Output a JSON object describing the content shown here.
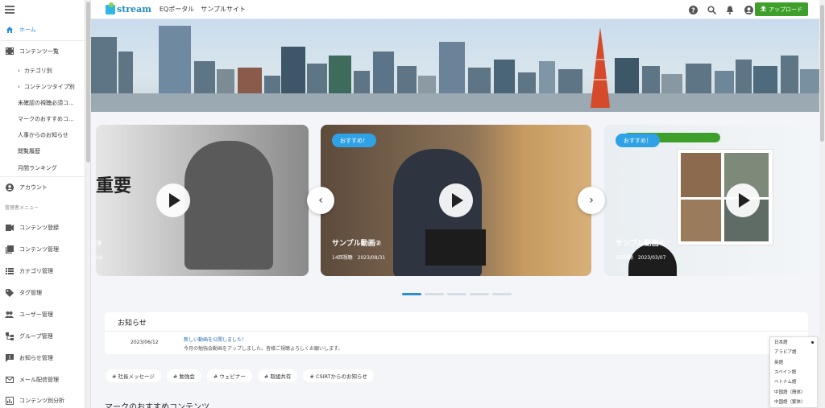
{
  "header": {
    "logo_text": "stream",
    "portal_label": "EQポータル",
    "site_label": "サンプルサイト",
    "upload_label": "アップロード",
    "icons": [
      "help-icon",
      "search-icon",
      "bell-icon",
      "account-icon"
    ]
  },
  "sidebar": {
    "items": [
      {
        "label": "ホーム",
        "icon": "home-icon"
      },
      {
        "label": "コンテンツ一覧",
        "icon": "film-icon"
      },
      {
        "label": "カテゴリ別"
      },
      {
        "label": "コンテンツタイプ別"
      },
      {
        "label": "未確認の視聴必須コ..."
      },
      {
        "label": "マークのおすすめコ..."
      },
      {
        "label": "人事からのお知らせ"
      },
      {
        "label": "閲覧履歴"
      },
      {
        "label": "月間ランキング"
      },
      {
        "label": "アカウント",
        "icon": "account-circle-icon"
      }
    ],
    "admin_section": "管理者メニュー",
    "admin_items": [
      {
        "label": "コンテンツ登録",
        "icon": "video-add-icon"
      },
      {
        "label": "コンテンツ管理",
        "icon": "video-library-icon"
      },
      {
        "label": "カテゴリ管理",
        "icon": "list-icon"
      },
      {
        "label": "タグ管理",
        "icon": "tag-icon"
      },
      {
        "label": "ユーザー管理",
        "icon": "people-icon"
      },
      {
        "label": "グループ管理",
        "icon": "group-tree-icon"
      },
      {
        "label": "お知らせ管理",
        "icon": "announcement-icon"
      },
      {
        "label": "メール配信管理",
        "icon": "mail-icon"
      },
      {
        "label": "コンテンツ別分析",
        "icon": "analytics-icon"
      }
    ]
  },
  "carousel": {
    "cards": [
      {
        "title": "③",
        "meta": "1A",
        "badge": "",
        "overlay_text": "重要"
      },
      {
        "title": "サンプル動画②",
        "meta": "14回視聴　2023/08/31",
        "badge": "おすすめ！"
      },
      {
        "title": "サンプル動画④",
        "meta": "9回視聴　2023/03/07",
        "badge": "おすすめ！"
      }
    ]
  },
  "news": {
    "heading": "お知らせ",
    "items": [
      {
        "date": "2023/06/12",
        "title": "新しい動画を公開しました！",
        "body": "今月の勉強会動画をアップしました。皆様ご視聴よろしくお願いします。"
      }
    ]
  },
  "tags": [
    "# 社長メッセージ",
    "# 勉強会",
    "# ウェビナー",
    "# 取組共有",
    "# CSIRTからのお知らせ"
  ],
  "section_title": "マークのおすすめコンテンツ",
  "languages": [
    "日本語",
    "アラビア語",
    "英語",
    "スペイン語",
    "ベトナム語",
    "中国語（簡体）",
    "中国語（繁体）"
  ],
  "colors": {
    "accent": "#2a8fd6",
    "upload": "#3ea02a",
    "badge": "#2fa2e6"
  }
}
